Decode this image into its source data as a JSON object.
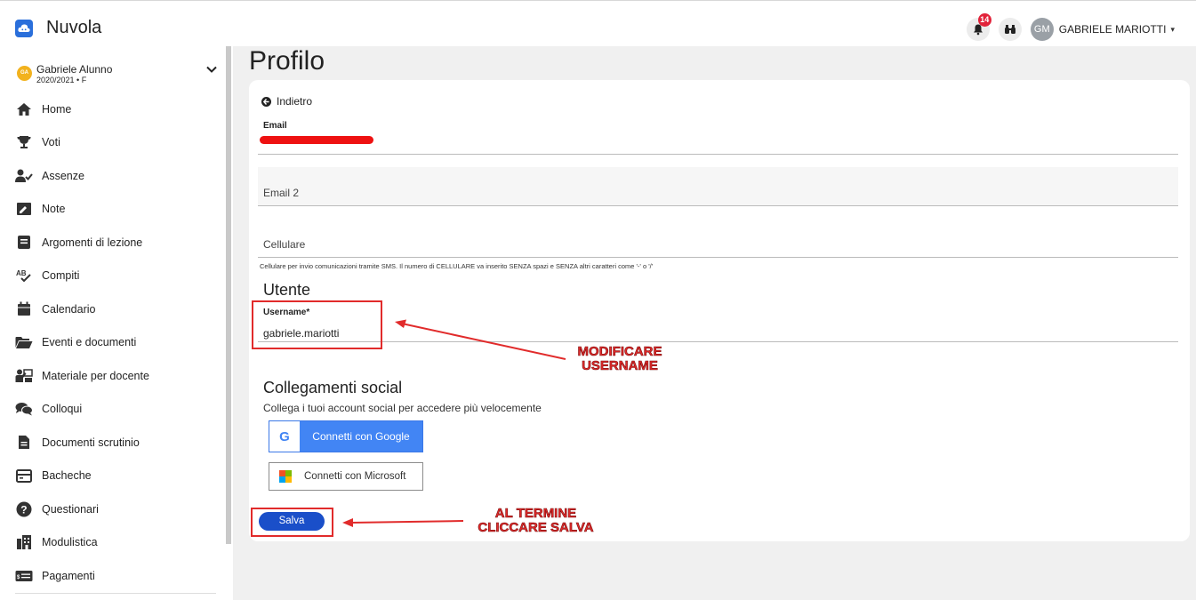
{
  "app": {
    "name": "Nuvola"
  },
  "topbar": {
    "notification_count": "14",
    "user_initials": "GM",
    "user_name": "GABRIELE MARIOTTI",
    "user_caret": "▾"
  },
  "sidebar": {
    "student": {
      "initials": "GA",
      "name": "Gabriele Alunno",
      "year": "2020/2021 • F"
    },
    "items": [
      {
        "label": "Home",
        "icon": "home-icon"
      },
      {
        "label": "Voti",
        "icon": "trophy-icon"
      },
      {
        "label": "Assenze",
        "icon": "user-check-icon"
      },
      {
        "label": "Note",
        "icon": "note-icon"
      },
      {
        "label": "Argomenti di lezione",
        "icon": "book-icon"
      },
      {
        "label": "Compiti",
        "icon": "spellcheck-icon"
      },
      {
        "label": "Calendario",
        "icon": "calendar-icon"
      },
      {
        "label": "Eventi e documenti",
        "icon": "folder-icon"
      },
      {
        "label": "Materiale per docente",
        "icon": "teacher-icon"
      },
      {
        "label": "Colloqui",
        "icon": "chat-icon"
      },
      {
        "label": "Documenti scrutinio",
        "icon": "document-icon"
      },
      {
        "label": "Bacheche",
        "icon": "board-icon"
      },
      {
        "label": "Questionari",
        "icon": "question-icon"
      },
      {
        "label": "Modulistica",
        "icon": "forms-icon"
      },
      {
        "label": "Pagamenti",
        "icon": "payment-icon"
      }
    ]
  },
  "main": {
    "title": "Profilo",
    "back_label": "Indietro",
    "email_label": "Email",
    "email2_label": "Email 2",
    "cellulare_label": "Cellulare",
    "cellulare_hint": "Cellulare per invio comunicazioni tramite SMS. Il numero di CELLULARE va inserito SENZA spazi e SENZA altri caratteri come '-' o '/'",
    "utente_title": "Utente",
    "username_label": "Username*",
    "username_value": "gabriele.mariotti",
    "social_title": "Collegamenti social",
    "social_desc": "Collega i tuoi account social per accedere più velocemente",
    "google_label": "Connetti con Google",
    "google_letter": "G",
    "microsoft_label": "Connetti con Microsoft",
    "save_label": "Salva"
  },
  "annotations": {
    "username_note_line1": "MODIFICARE",
    "username_note_line2": "USERNAME",
    "save_note_line1": "AL TERMINE",
    "save_note_line2": "CLICCARE SALVA",
    "color": "#e12b2b"
  },
  "colors": {
    "primary": "#1a4fc9",
    "google_blue": "#4285f4",
    "badge_red": "#e2233a",
    "student_badge": "#f2b21e"
  }
}
